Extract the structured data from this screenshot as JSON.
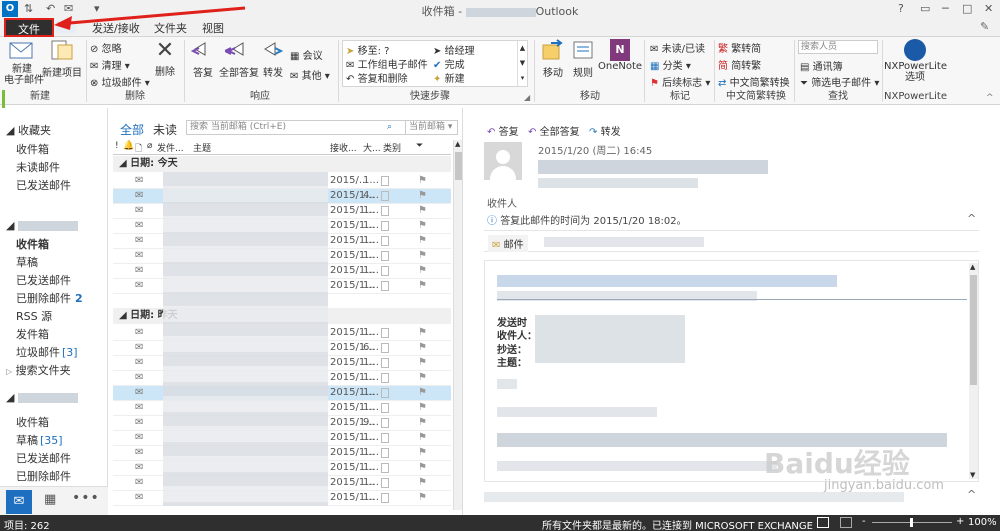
{
  "window": {
    "title": "收件箱 - ",
    "app": "Outlook"
  },
  "tabs": [
    "文件",
    "发送/接收",
    "文件夹",
    "视图"
  ],
  "ribbon": {
    "new": {
      "new_email": "新建\n电子邮件",
      "new_items": "新建项目",
      "label": "新建"
    },
    "delete": {
      "ignore": "忽略",
      "cleanup": "清理",
      "junk": "垃圾邮件",
      "delete": "删除",
      "label": "删除"
    },
    "respond": {
      "reply": "答复",
      "reply_all": "全部答复",
      "forward": "转发",
      "meeting": "会议",
      "more": "其他",
      "label": "响应"
    },
    "quicksteps": {
      "move_to": "移至: ?",
      "team_email": "工作组电子邮件",
      "reply_delete": "答复和删除",
      "to_manager": "给经理",
      "done": "完成",
      "create_new": "新建",
      "label": "快速步骤"
    },
    "move": {
      "move": "移动",
      "rules": "规则",
      "onenote": "OneNote",
      "label": "移动"
    },
    "tags": {
      "unread_read": "未读/已读",
      "categorize": "分类",
      "followup": "后续标志",
      "label": "标记"
    },
    "chinese": {
      "to_trad": "繁转简",
      "to_simp": "简转繁",
      "convert": "中文简繁转换",
      "label": "中文简繁转换"
    },
    "find": {
      "search_people": "搜索人员",
      "address_book": "通讯簿",
      "filter_email": "筛选电子邮件",
      "label": "查找"
    },
    "nxpower": {
      "options": "NXPowerLite\n选项",
      "label": "NXPowerLite"
    }
  },
  "folders": {
    "favorites": "收藏夹",
    "fav_items": [
      "收件箱",
      "未读邮件",
      "已发送邮件"
    ],
    "account_items": [
      {
        "label": "收件箱",
        "bold": true
      },
      {
        "label": "草稿"
      },
      {
        "label": "已发送邮件"
      },
      {
        "label": "已删除邮件",
        "count": "2"
      },
      {
        "label": "RSS 源"
      },
      {
        "label": "发件箱"
      },
      {
        "label": "垃圾邮件",
        "count": "[3]"
      },
      {
        "label": "搜索文件夹"
      }
    ],
    "account2_items": [
      {
        "label": "收件箱"
      },
      {
        "label": "草稿",
        "count": "[35]"
      },
      {
        "label": "已发送邮件"
      },
      {
        "label": "已删除邮件"
      }
    ]
  },
  "list": {
    "filter_all": "全部",
    "filter_unread": "未读",
    "search_placeholder": "搜索 当前邮箱 (Ctrl+E)",
    "scope": "当前邮箱",
    "columns": [
      "发件...",
      "主题",
      "接收...",
      "大...",
      "类别"
    ],
    "group_today": "日期: 今天",
    "group_yesterday": "日期: 昨天",
    "today_rows": [
      {
        "date": "2015/...",
        "size": "1..."
      },
      {
        "date": "2015/1...",
        "size": "4...",
        "selected": true
      },
      {
        "date": "2015/1...",
        "size": "1..."
      },
      {
        "date": "2015/1...",
        "size": "1..."
      },
      {
        "date": "2015/1...",
        "size": "1..."
      },
      {
        "date": "2015/1...",
        "size": "1..."
      },
      {
        "date": "2015/1...",
        "size": "1..."
      },
      {
        "date": "2015/1...",
        "size": "1..."
      }
    ],
    "yesterday_rows": [
      {
        "date": "2015/1...",
        "size": "1..."
      },
      {
        "date": "2015/1...",
        "size": "6..."
      },
      {
        "date": "2015/1...",
        "size": "1..."
      },
      {
        "date": "2015/1...",
        "size": "1..."
      },
      {
        "date": "2015/1...",
        "size": "1...",
        "selected": true
      },
      {
        "date": "2015/1...",
        "size": "1..."
      },
      {
        "date": "2015/1...",
        "size": "9..."
      },
      {
        "date": "2015/1...",
        "size": "1..."
      },
      {
        "date": "2015/1...",
        "size": "1..."
      },
      {
        "date": "2015/1...",
        "size": "1..."
      },
      {
        "date": "2015/1...",
        "size": "1..."
      },
      {
        "date": "2015/1...",
        "size": "1..."
      }
    ]
  },
  "reading": {
    "reply": "答复",
    "reply_all": "全部答复",
    "forward": "转发",
    "datetime": "2015/1/20 (周二) 16:45",
    "to_label": "收件人",
    "info": "答复此邮件的时间为 2015/1/20 18:02。",
    "attachment": "邮件",
    "fields": [
      "发送时",
      "收件人：",
      "抄送：",
      "主题："
    ]
  },
  "status": {
    "items": "项目: 262",
    "all_updated": "所有文件夹都是最新的。",
    "connected": "已连接到 MICROSOFT EXCHANGE",
    "zoom": "100%"
  },
  "watermark": {
    "brand": "Baidu经验",
    "url": "jingyan.baidu.com"
  },
  "colors": {
    "accent": "#1e6fbf",
    "file_tab": "#2f2f2f",
    "annotation": "#e0201a",
    "selection": "#cde6f7"
  }
}
